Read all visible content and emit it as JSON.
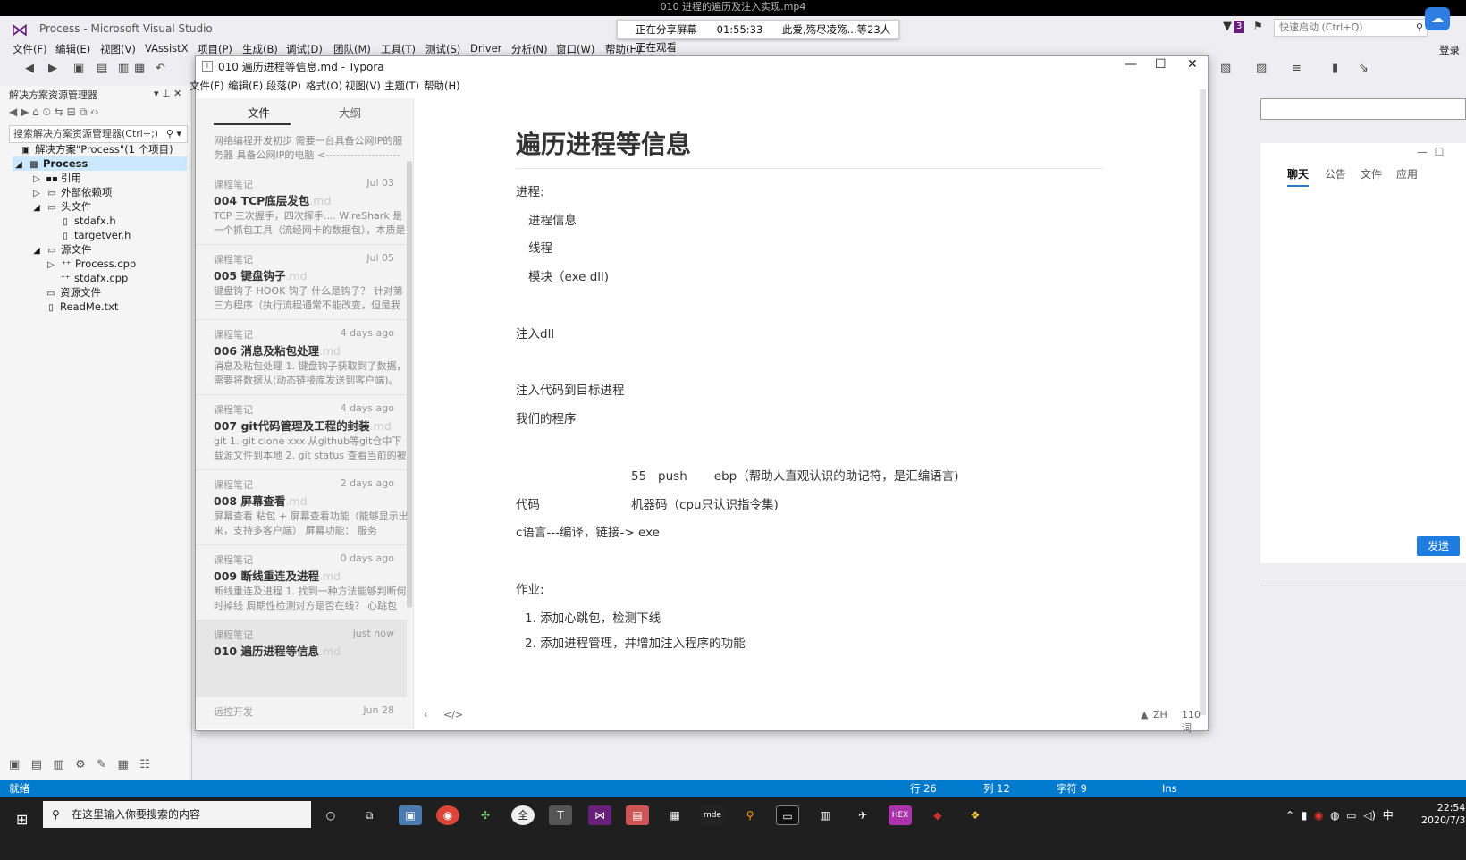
{
  "video": {
    "title": "010 进程的遍历及注入实现.mp4"
  },
  "share": {
    "status": "正在分享屏幕",
    "time": "01:55:33",
    "viewers": "此爱,殇尽凌殇...等23人正在观看"
  },
  "vs": {
    "title": "Process - Microsoft Visual Studio",
    "notif_count": "3",
    "quick_launch": "快速启动 (Ctrl+Q)",
    "login": "登录",
    "menu": [
      "文件(F)",
      "编辑(E)",
      "视图(V)",
      "VAssistX",
      "项目(P)",
      "生成(B)",
      "调试(D)",
      "团队(M)",
      "工具(T)",
      "测试(S)",
      "Driver",
      "分析(N)",
      "窗口(W)",
      "帮助(H)"
    ]
  },
  "solution_explorer": {
    "title": "解决方案资源管理器",
    "search_placeholder": "搜索解决方案资源管理器(Ctrl+;)",
    "items": [
      {
        "label": "解决方案\"Process\"(1 个项目)"
      },
      {
        "label": "Process"
      },
      {
        "label": "引用"
      },
      {
        "label": "外部依赖项"
      },
      {
        "label": "头文件"
      },
      {
        "label": "stdafx.h"
      },
      {
        "label": "targetver.h"
      },
      {
        "label": "源文件"
      },
      {
        "label": "Process.cpp"
      },
      {
        "label": "stdafx.cpp"
      },
      {
        "label": "资源文件"
      },
      {
        "label": "ReadMe.txt"
      }
    ]
  },
  "status_bar": {
    "ready": "就绪",
    "line": "行 26",
    "col": "列 12",
    "char": "字符 9",
    "mode": "Ins"
  },
  "taskbar": {
    "search_placeholder": "在这里输入你要搜索的内容",
    "time": "22:54",
    "date": "2020/7/3",
    "ime": "中"
  },
  "chat": {
    "tabs": [
      "聊天",
      "公告",
      "文件",
      "应用"
    ],
    "send": "发送"
  },
  "typora": {
    "title": "010 遍历进程等信息.md - Typora",
    "menu": [
      "文件(F)",
      "编辑(E)",
      "段落(P)",
      "格式(O)",
      "视图(V)",
      "主题(T)",
      "帮助(H)"
    ],
    "tab_files": "文件",
    "tab_outline": "大纲",
    "first_excerpt": "网络编程开发初步 需要一台具备公网IP的服务器 具备公网IP的电脑 <---------------------",
    "files": [
      {
        "cat": "课程笔记",
        "date": "Jul 03",
        "title": "004 TCP底层发包",
        "ext": ".md",
        "excerpt": "TCP 三次握手，四次挥手.... WireShark 是一个抓包工具（流经网卡的数据包），本质是"
      },
      {
        "cat": "课程笔记",
        "date": "Jul 05",
        "title": "005 键盘钩子",
        "ext": ".md",
        "excerpt": "键盘钩子 HOOK 钩子 什么是钩子？ 针对第三方程序（执行流程通常不能改变，但是我"
      },
      {
        "cat": "课程笔记",
        "date": "4 days ago",
        "title": "006 消息及粘包处理",
        "ext": ".md",
        "excerpt": "消息及粘包处理 1. 键盘钩子获取到了数据，需要将数据从(动态链接库发送到客户端)。"
      },
      {
        "cat": "课程笔记",
        "date": "4 days ago",
        "title": "007 git代码管理及工程的封装",
        "ext": ".md",
        "excerpt": "git 1. git clone xxx 从github等git仓中下载源文件到本地 2. git status 查看当前的被管理"
      },
      {
        "cat": "课程笔记",
        "date": "2 days ago",
        "title": "008 屏幕查看",
        "ext": ".md",
        "excerpt": "屏幕查看 粘包 + 屏幕查看功能（能够显示出来，支持多客户端） 屏幕功能： 服务"
      },
      {
        "cat": "课程笔记",
        "date": "0 days ago",
        "title": "009 断线重连及进程",
        "ext": ".md",
        "excerpt": "断线重连及进程 1. 找到一种方法能够判断何时掉线 周期性检测对方是否在线？ 心跳包"
      },
      {
        "cat": "课程笔记",
        "date": "just now",
        "title": "010 遍历进程等信息",
        "ext": ".md",
        "excerpt": ""
      },
      {
        "cat": "远控开发",
        "date": "Jun 28",
        "title": "",
        "ext": "",
        "excerpt": ""
      }
    ],
    "doc": {
      "title": "遍历进程等信息",
      "l1": "进程:",
      "l2": "进程信息",
      "l3": "线程",
      "l4": "模块（exe dll)",
      "l5": "注入dll",
      "l6": "注入代码到目标进程",
      "l7": "我们的程序",
      "l8": "55   push       ebp（帮助人直观认识的助记符，是汇编语言)",
      "l9a": "代码",
      "l9b": "机器码（cpu只认识指令集)",
      "l10": "c语言---编译，链接-> exe",
      "l11": "作业:",
      "l12": "1. 添加心跳包，检测下线",
      "l13": "2. 添加进程管理，并增加注入程序的功能"
    },
    "status": {
      "lang": "ZH",
      "words": "110 词"
    }
  }
}
